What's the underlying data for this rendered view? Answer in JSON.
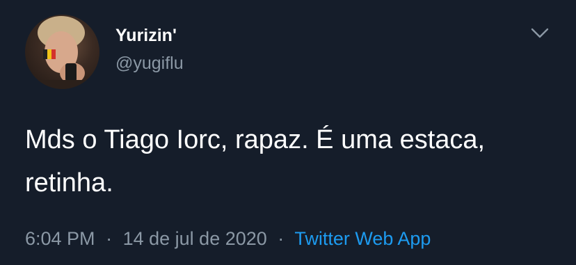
{
  "user": {
    "display_name": "Yurizin'",
    "handle": "@yugiflu"
  },
  "tweet": {
    "text": "Mds o Tiago Iorc, rapaz. É uma estaca, retinha.",
    "time": "6:04 PM",
    "date": "14 de jul de 2020",
    "source": "Twitter Web App",
    "separator": "·"
  },
  "icons": {
    "more_options": "chevron-down-icon"
  },
  "colors": {
    "background": "#151d2a",
    "primary_text": "#ffffff",
    "secondary_text": "#8b98a5",
    "link": "#1d9bf0"
  }
}
